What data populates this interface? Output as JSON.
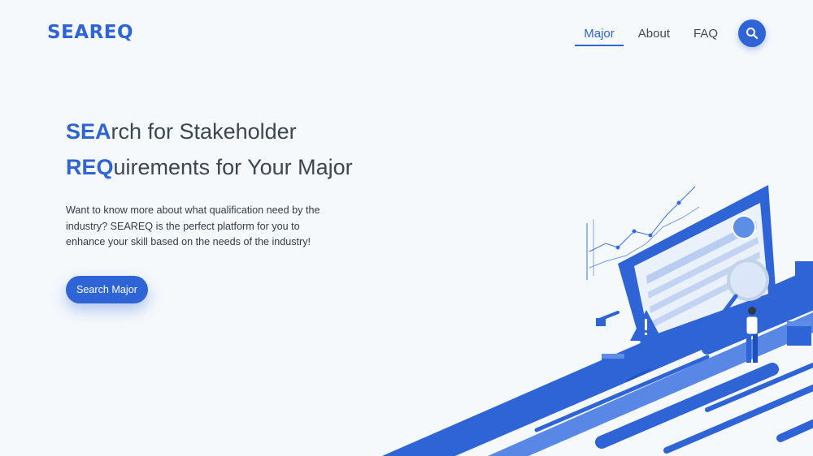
{
  "brand": {
    "logo": "SEAREQ",
    "accent_color": "#2f64d6"
  },
  "nav": {
    "items": [
      {
        "label": "Major",
        "active": true
      },
      {
        "label": "About",
        "active": false
      },
      {
        "label": "FAQ",
        "active": false
      }
    ],
    "search_icon": "magnifier-icon"
  },
  "hero": {
    "line1_highlight": "SEA",
    "line1_rest": "rch for Stakeholder",
    "line2_highlight": "REQ",
    "line2_rest": "uirements for Your Major",
    "description": "Want to know more about what qualification need by the industry? SEAREQ is the perfect platform for you to enhance your skill based on the needs of the industry!",
    "cta_label": "Search Major"
  },
  "illustration": {
    "icon": "data-analysis-illustration"
  }
}
